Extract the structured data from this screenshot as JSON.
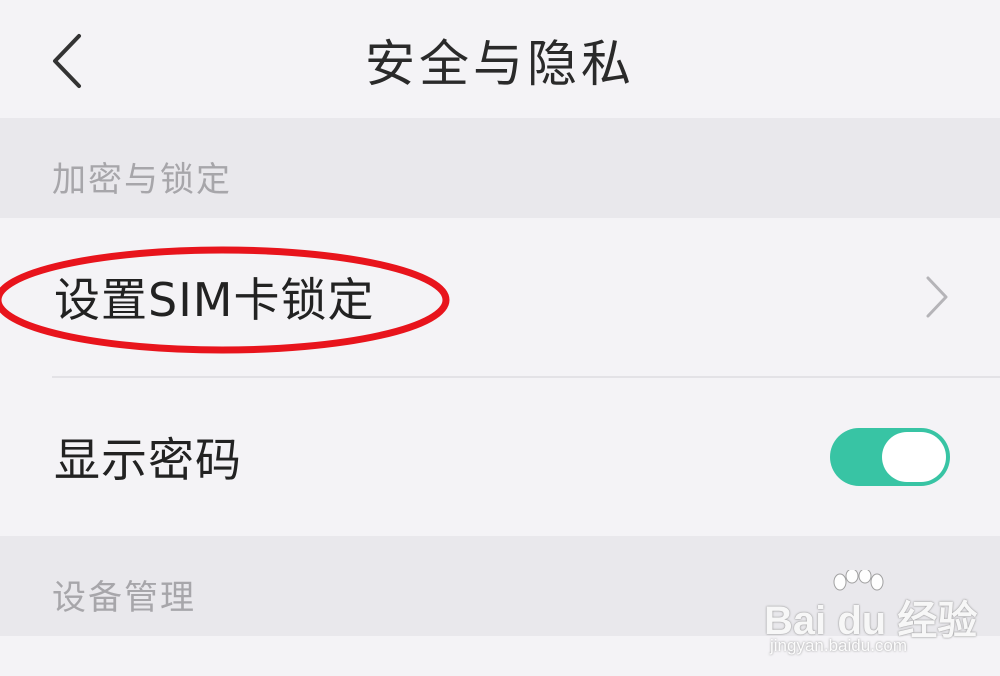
{
  "header": {
    "title": "安全与隐私",
    "back_icon": "chevron-left-icon"
  },
  "sections": [
    {
      "label": "加密与锁定",
      "items": [
        {
          "label": "设置SIM卡锁定",
          "control": "chevron-right-icon"
        },
        {
          "label": "显示密码",
          "control": "toggle",
          "toggle_on": true
        }
      ]
    },
    {
      "label": "设备管理"
    }
  ],
  "annotation": {
    "shape": "oval",
    "color": "#e8141c",
    "target": "设置SIM卡锁定"
  },
  "colors": {
    "accent": "#38c4a4",
    "background": "#f4f3f6",
    "section_bg": "#e9e8ec"
  },
  "watermark": {
    "brand": "Bai du 经验",
    "url": "jingyan.baidu.com"
  }
}
